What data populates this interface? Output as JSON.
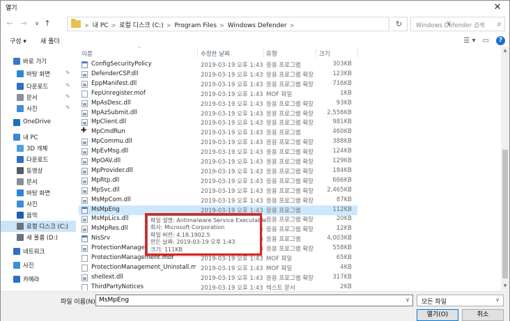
{
  "window": {
    "title": "열기",
    "close_glyph": "✕"
  },
  "nav": {
    "back": "←",
    "forward": "→",
    "recent": "∨",
    "up": "↑",
    "breadcrumb": [
      "내 PC",
      "로컬 디스크 (C:)",
      "Program Files",
      "Windows Defender"
    ],
    "breadcrumb_sep": ">",
    "refresh": "↻",
    "search_placeholder": "Windows Defender 검색"
  },
  "toolbar": {
    "organize": "구성 ▾",
    "new_folder": "새 폴더"
  },
  "sidebar": {
    "items": [
      {
        "label": "바로 가기",
        "icon": "star-icon",
        "color": "#3a78c9"
      },
      {
        "label": "바탕 화면",
        "icon": "desktop-icon",
        "color": "#2f86d8",
        "pinned": true
      },
      {
        "label": "다운로드",
        "icon": "download-icon",
        "color": "#2f6fc4",
        "pinned": true
      },
      {
        "label": "문서",
        "icon": "document-icon",
        "color": "#8a8f99",
        "pinned": true
      },
      {
        "label": "사진",
        "icon": "pictures-icon",
        "color": "#3d8fd6",
        "pinned": true
      },
      {
        "label": "OneDrive",
        "icon": "cloud-icon",
        "color": "#1e6fc2"
      },
      {
        "label": "내 PC",
        "icon": "pc-icon",
        "color": "#3b87d3"
      },
      {
        "label": "3D 개체",
        "icon": "3d-objects-icon",
        "color": "#4aa3e0"
      },
      {
        "label": "다운로드",
        "icon": "download-icon",
        "color": "#2f6fc4"
      },
      {
        "label": "동영상",
        "icon": "video-icon",
        "color": "#555b66"
      },
      {
        "label": "문서",
        "icon": "document-icon",
        "color": "#8a8f99"
      },
      {
        "label": "바탕 화면",
        "icon": "desktop-icon",
        "color": "#2f86d8"
      },
      {
        "label": "사진",
        "icon": "pictures-icon",
        "color": "#3d8fd6"
      },
      {
        "label": "음악",
        "icon": "music-icon",
        "color": "#1e5fb0"
      },
      {
        "label": "로컬 디스크 (C:)",
        "icon": "drive-icon",
        "color": "#6b7380",
        "selected": true
      },
      {
        "label": "새 볼륨 (D:)",
        "icon": "drive-icon",
        "color": "#6b7380"
      },
      {
        "label": "네트워크",
        "icon": "network-icon",
        "color": "#2f6fc4"
      },
      {
        "label": "사진",
        "icon": "pictures-icon",
        "color": "#3d8fd6"
      },
      {
        "label": "카메라",
        "icon": "camera-icon",
        "color": "#2f6fc4"
      }
    ],
    "pin_glyph": "✎"
  },
  "columns": {
    "name": "이름",
    "date": "수정한 날짜",
    "type": "유형",
    "size": "크기",
    "sort_glyph": "^"
  },
  "files": [
    {
      "name": "ConfigSecurityPolicy",
      "date": "2019-03-19 오후 1:43",
      "type": "응용 프로그램",
      "size": "303KB",
      "kind": "exe"
    },
    {
      "name": "DefenderCSP.dll",
      "date": "2019-03-19 오후 1:43",
      "type": "응용 프로그램 확장",
      "size": "123KB",
      "kind": "dll"
    },
    {
      "name": "EppManifest.dll",
      "date": "2019-03-19 오후 1:43",
      "type": "응용 프로그램 확장",
      "size": "716KB",
      "kind": "dll"
    },
    {
      "name": "FepUnregister.mof",
      "date": "2019-03-19 오후 1:43",
      "type": "MOF 파일",
      "size": "1KB",
      "kind": "file"
    },
    {
      "name": "MpAsDesc.dll",
      "date": "2019-03-19 오후 1:43",
      "type": "응용 프로그램 확장",
      "size": "93KB",
      "kind": "dll"
    },
    {
      "name": "MpAzSubmit.dll",
      "date": "2019-03-19 오후 1:43",
      "type": "응용 프로그램 확장",
      "size": "2,556KB",
      "kind": "dll"
    },
    {
      "name": "MpClient.dll",
      "date": "2019-03-19 오후 1:43",
      "type": "응용 프로그램 확장",
      "size": "981KB",
      "kind": "dll"
    },
    {
      "name": "MpCmdRun",
      "date": "2019-03-19 오후 1:43",
      "type": "응용 프로그램",
      "size": "460KB",
      "kind": "shield"
    },
    {
      "name": "MpCommu.dll",
      "date": "2019-03-19 오후 1:43",
      "type": "응용 프로그램 확장",
      "size": "388KB",
      "kind": "dll"
    },
    {
      "name": "MpEvMsg.dll",
      "date": "2019-03-19 오후 1:43",
      "type": "응용 프로그램 확장",
      "size": "124KB",
      "kind": "dll"
    },
    {
      "name": "MpOAV.dll",
      "date": "2019-03-19 오후 1:43",
      "type": "응용 프로그램 확장",
      "size": "129KB",
      "kind": "dll"
    },
    {
      "name": "MpProvider.dll",
      "date": "2019-03-19 오후 1:43",
      "type": "응용 프로그램 확장",
      "size": "184KB",
      "kind": "dll"
    },
    {
      "name": "MpRtp.dll",
      "date": "2019-03-19 오후 1:43",
      "type": "응용 프로그램 확장",
      "size": "666KB",
      "kind": "dll"
    },
    {
      "name": "MpSvc.dll",
      "date": "2019-03-19 오후 1:43",
      "type": "응용 프로그램 확장",
      "size": "2,465KB",
      "kind": "dll"
    },
    {
      "name": "MsMpCom.dll",
      "date": "2019-03-19 오후 1:43",
      "type": "응용 프로그램 확장",
      "size": "87KB",
      "kind": "dll"
    },
    {
      "name": "MsMpEng",
      "date": "2019-03-19 오후 1:43",
      "type": "응용 프로그램",
      "size": "112KB",
      "kind": "exe",
      "selected": true
    },
    {
      "name": "MsMpLics.dll",
      "date": "2019-03-19 오후 1:43",
      "type": "응용 프로그램 확장",
      "size": "20KB",
      "kind": "dll"
    },
    {
      "name": "MsMpRes.dll",
      "date": "2019-03-19 오후 1:43",
      "type": "응용 프로그램 확장",
      "size": "12KB",
      "kind": "dll"
    },
    {
      "name": "NisSrv",
      "date": "2019-03-19 오후 1:43",
      "type": "응용 프로그램",
      "size": "4,003KB",
      "kind": "exe"
    },
    {
      "name": "ProtectionManagement.dll",
      "date": "2019-03-19 오후 1:43",
      "type": "응용 프로그램 확장",
      "size": "558KB",
      "kind": "dll"
    },
    {
      "name": "ProtectionManagement.mof",
      "date": "2019-03-19 오후 1:43",
      "type": "MOF 파일",
      "size": "65KB",
      "kind": "file"
    },
    {
      "name": "ProtectionManagement_Uninstall.mof",
      "date": "2019-03-19 오후 1:43",
      "type": "MOF 파일",
      "size": "4KB",
      "kind": "file"
    },
    {
      "name": "shellext.dll",
      "date": "2019-03-19 오후 1:43",
      "type": "응용 프로그램 확장",
      "size": "317KB",
      "kind": "dll"
    },
    {
      "name": "ThirdPartyNotices",
      "date": "2019-03-19 오후 1:43",
      "type": "텍스트 문서",
      "size": "2KB",
      "kind": "file"
    }
  ],
  "tooltip": {
    "lines": [
      "파일 설명: Antimalware Service Executable",
      "회사: Microsoft Corporation",
      "파일 버전: 4.18.1902.5",
      "만든 날짜: 2019-03-19 오후 1:43",
      "크기: 111KB"
    ]
  },
  "footer": {
    "filename_label": "파일 이름(N):",
    "filename_value": "MsMpEng",
    "filter_value": "모든 파일",
    "open_label": "열기(O)",
    "cancel_label": "취소",
    "dropdown_glyph": "∨"
  },
  "colors": {
    "selection": "#cce8ff",
    "highlight_border": "#e02020",
    "accent": "#0078d7"
  }
}
